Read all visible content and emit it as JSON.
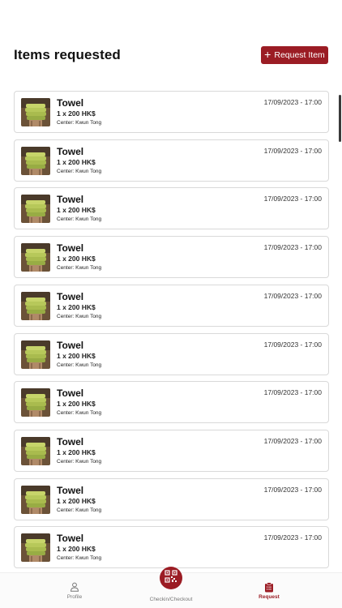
{
  "header": {
    "title": "Items requested",
    "request_button_label": "Request Item",
    "request_button_icon": "plus-icon"
  },
  "items": [
    {
      "name": "Towel",
      "quantity": "1 x 200 HK$",
      "center": "Center: Kwun Tong",
      "datetime": "17/09/2023 - 17:00"
    },
    {
      "name": "Towel",
      "quantity": "1 x 200 HK$",
      "center": "Center: Kwun Tong",
      "datetime": "17/09/2023 - 17:00"
    },
    {
      "name": "Towel",
      "quantity": "1 x 200 HK$",
      "center": "Center: Kwun Tong",
      "datetime": "17/09/2023 - 17:00"
    },
    {
      "name": "Towel",
      "quantity": "1 x 200 HK$",
      "center": "Center: Kwun Tong",
      "datetime": "17/09/2023 - 17:00"
    },
    {
      "name": "Towel",
      "quantity": "1 x 200 HK$",
      "center": "Center: Kwun Tong",
      "datetime": "17/09/2023 - 17:00"
    },
    {
      "name": "Towel",
      "quantity": "1 x 200 HK$",
      "center": "Center: Kwun Tong",
      "datetime": "17/09/2023 - 17:00"
    },
    {
      "name": "Towel",
      "quantity": "1 x 200 HK$",
      "center": "Center: Kwun Tong",
      "datetime": "17/09/2023 - 17:00"
    },
    {
      "name": "Towel",
      "quantity": "1 x 200 HK$",
      "center": "Center: Kwun Tong",
      "datetime": "17/09/2023 - 17:00"
    },
    {
      "name": "Towel",
      "quantity": "1 x 200 HK$",
      "center": "Center: Kwun Tong",
      "datetime": "17/09/2023 - 17:00"
    },
    {
      "name": "Towel",
      "quantity": "1 x 200 HK$",
      "center": "Center: Kwun Tong",
      "datetime": "17/09/2023 - 17:00"
    }
  ],
  "bottom_nav": {
    "profile_label": "Profile",
    "checkin_label": "Checkin/Checkout",
    "request_label": "Request",
    "active": "Request"
  },
  "colors": {
    "accent": "#9b1c24",
    "card_border": "#d9d9d9",
    "nav_inactive": "#777777"
  }
}
